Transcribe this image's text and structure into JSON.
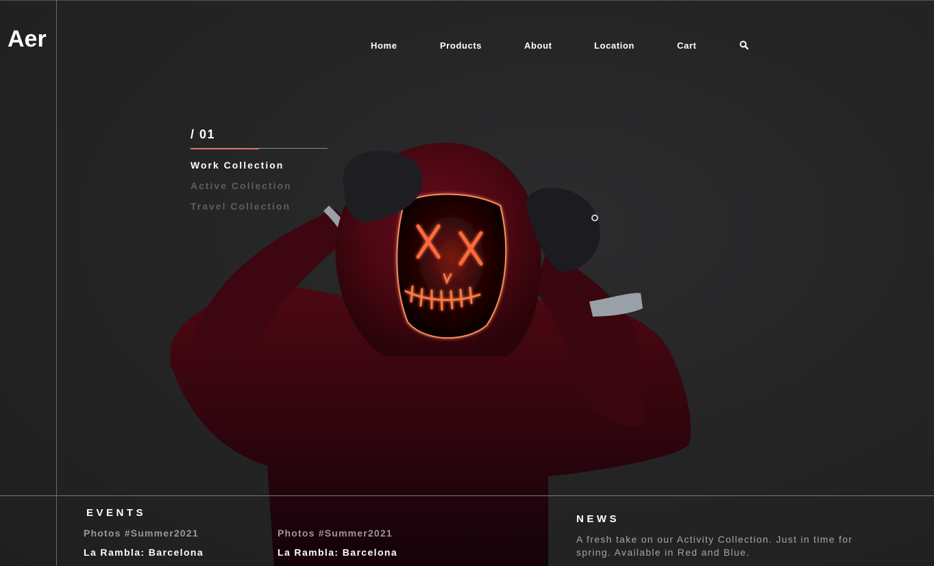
{
  "brand": {
    "logo": "Aer"
  },
  "nav": {
    "items": [
      {
        "label": "Home"
      },
      {
        "label": "Products"
      },
      {
        "label": "About"
      },
      {
        "label": "Location"
      },
      {
        "label": "Cart"
      }
    ],
    "search_icon": "search-icon"
  },
  "collections": {
    "index": "/ 01",
    "progress": 0.5,
    "items": [
      {
        "label": "Work Collection",
        "active": true
      },
      {
        "label": "Active Collection",
        "active": false
      },
      {
        "label": "Travel Collection",
        "active": false
      }
    ]
  },
  "hero": {
    "image": "person-in-red-hoodie-with-glowing-neon-mask"
  },
  "events": {
    "title": "EVENTS",
    "items": [
      {
        "category": "Photos #Summer2021",
        "title": "La Rambla: Barcelona"
      },
      {
        "category": "Photos #Summer2021",
        "title": "La Rambla: Barcelona"
      }
    ]
  },
  "news": {
    "title": "NEWS",
    "text": "A fresh take on our Activity Collection. Just in time for spring. Available in Red and Blue."
  },
  "colors": {
    "background": "#252526",
    "accent": "#e0766b",
    "text": "#ffffff",
    "muted": "#5e5e5e",
    "hoodie": "#5a0a16",
    "neon": "#ff6a3d"
  }
}
